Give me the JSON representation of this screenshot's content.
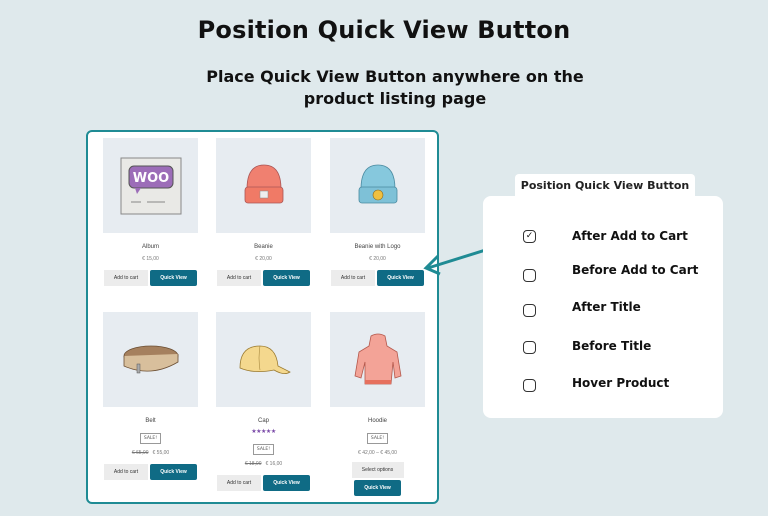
{
  "header": {
    "title": "Position Quick View Button",
    "subtitle": "Place Quick View Button anywhere on the product listing page"
  },
  "products": [
    {
      "name": "Album",
      "price": "€ 15,00",
      "add_to_cart": "Add to cart",
      "quick_view": "Quick View"
    },
    {
      "name": "Beanie",
      "price": "€ 20,00",
      "add_to_cart": "Add to cart",
      "quick_view": "Quick View"
    },
    {
      "name": "Beanie with Logo",
      "price": "€ 20,00",
      "add_to_cart": "Add to cart",
      "quick_view": "Quick View"
    },
    {
      "name": "Belt",
      "badge": "SALE!",
      "old_price": "€ 65,00",
      "price": "€ 55,00",
      "add_to_cart": "Add to cart",
      "quick_view": "Quick View"
    },
    {
      "name": "Cap",
      "rating": "★★★★★",
      "badge": "SALE!",
      "old_price": "€ 18,00",
      "price": "€ 16,00",
      "add_to_cart": "Add to cart",
      "quick_view": "Quick View"
    },
    {
      "name": "Hoodie",
      "badge": "SALE!",
      "price": "€ 42,00 – € 45,00",
      "select_options": "Select options",
      "quick_view": "Quick View"
    }
  ],
  "settings_panel": {
    "title": "Position Quick View Button",
    "options": [
      {
        "label": "After Add to Cart",
        "checked": true,
        "mark": "✓"
      },
      {
        "label": "Before Add to Cart",
        "checked": false
      },
      {
        "label": "After Title",
        "checked": false
      },
      {
        "label": "Before Title",
        "checked": false
      },
      {
        "label": "Hover Product",
        "checked": false
      }
    ]
  },
  "colors": {
    "accent": "#1f8b94",
    "button": "#0f6b85",
    "background": "#dfe9ec"
  }
}
